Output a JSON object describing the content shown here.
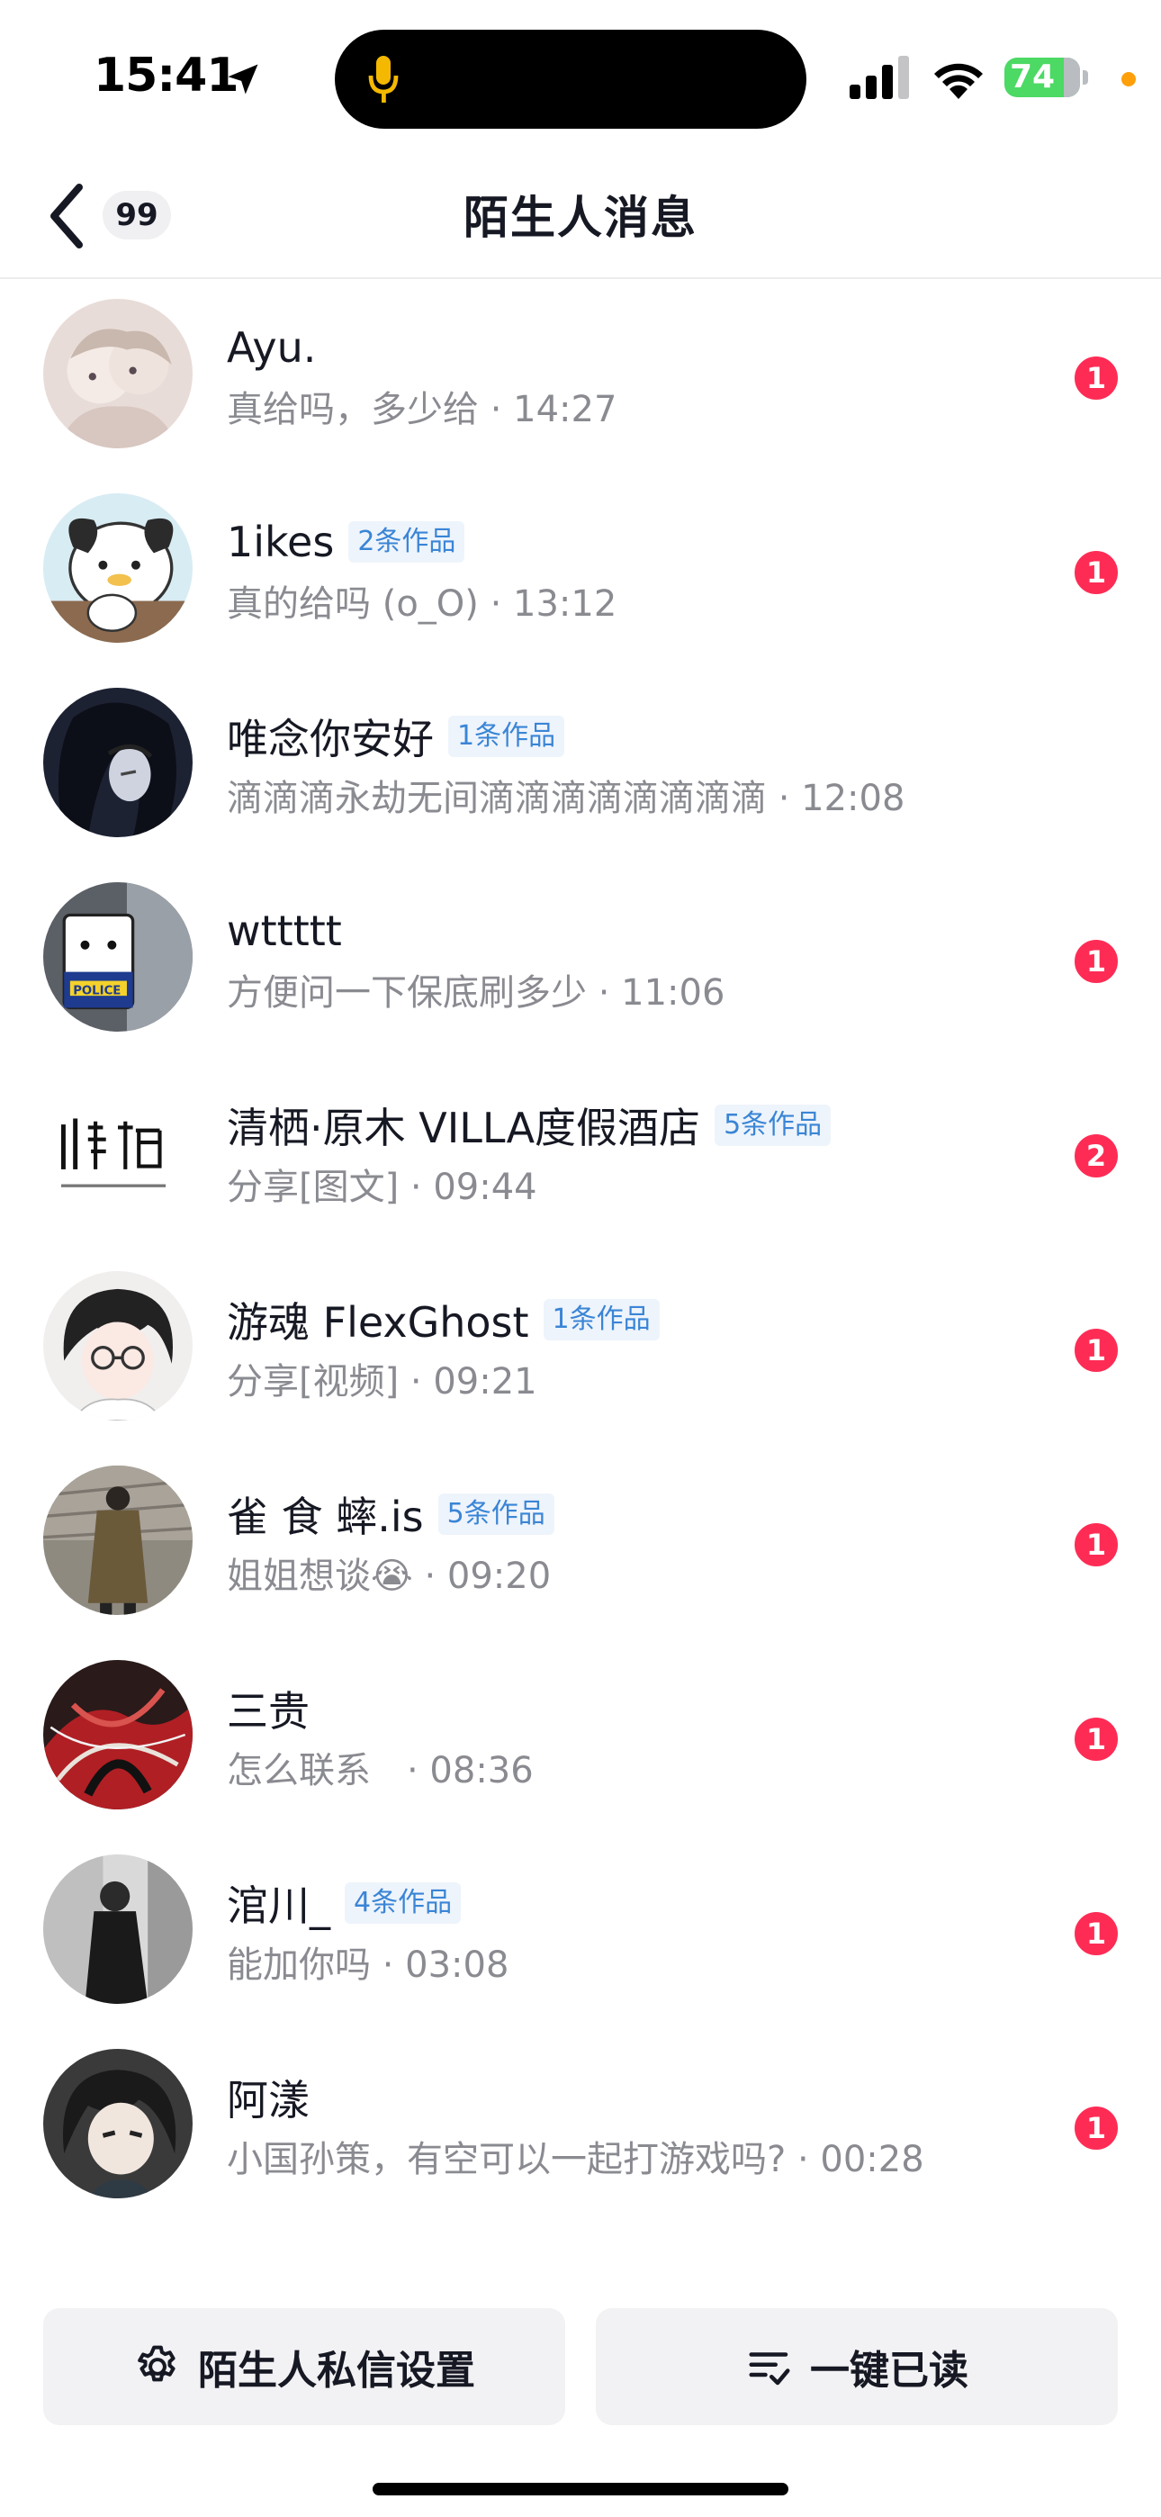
{
  "status_bar": {
    "time": "15:41",
    "battery": "74",
    "icons": [
      "location-arrow-icon",
      "microphone-icon",
      "cellular-signal-icon",
      "wifi-icon",
      "battery-icon"
    ]
  },
  "nav": {
    "back_icon": "chevron-left-icon",
    "unread_count": "99",
    "title": "陌生人消息"
  },
  "messages": [
    {
      "name": "Ayu.",
      "tag": "",
      "preview": "真给吗，多少给 · 14:27",
      "unread": "1"
    },
    {
      "name": "1ikes",
      "tag": "2条作品",
      "preview": "真的给吗 (o_O) · 13:12",
      "unread": "1"
    },
    {
      "name": "唯念你安好",
      "tag": "1条作品",
      "preview": "滴滴滴永劫无间滴滴滴滴滴滴滴滴 · 12:08",
      "unread": ""
    },
    {
      "name": "wttttt",
      "tag": "",
      "preview": "方便问一下保底刷多少 · 11:06",
      "unread": "1"
    },
    {
      "name": "清栖·原木 VILLA度假酒店",
      "tag": "5条作品",
      "preview": "分享[图文] · 09:44",
      "unread": "2"
    },
    {
      "name": "游魂 FlexGhost",
      "tag": "1条作品",
      "preview": "分享[视频] · 09:21",
      "unread": "1"
    },
    {
      "name": "雀 食 蟀.is",
      "tag": "5条作品",
      "preview": "姐姐想谈😭 · 09:20",
      "unread": "1"
    },
    {
      "name": "三贵",
      "tag": "",
      "preview": "怎么联系　· 08:36",
      "unread": "1"
    },
    {
      "name": "涫川_",
      "tag": "4条作品",
      "preview": "能加你吗 · 03:08",
      "unread": "1"
    },
    {
      "name": "阿漾",
      "tag": "",
      "preview": "小国孙策，有空可以一起打游戏吗? · 00:28",
      "unread": "1"
    }
  ],
  "bottom": {
    "settings_label": "陌生人私信设置",
    "settings_icon": "gear-icon",
    "mark_read_label": "一键已读",
    "mark_read_icon": "list-check-icon"
  },
  "colors": {
    "accent_red": "#fe2c55",
    "tag_blue": "#3a85d6",
    "secondary_text": "#8a8b91"
  }
}
